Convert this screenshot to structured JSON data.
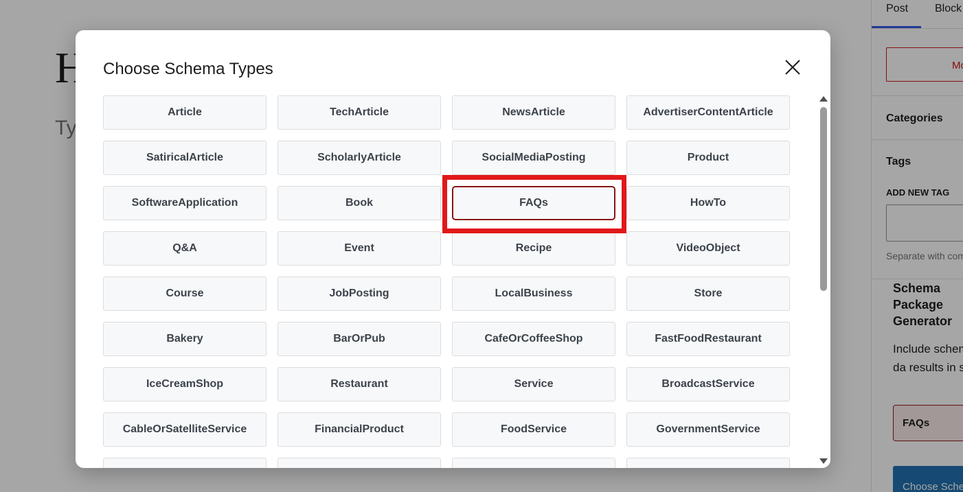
{
  "editor": {
    "title_fragment": "H",
    "placeholder_fragment": "Ty"
  },
  "sidebar": {
    "tabs": [
      {
        "label": "Post",
        "active": true
      },
      {
        "label": "Block",
        "active": false
      }
    ],
    "move_button_fragment": "Mo",
    "categories_heading": "Categories",
    "tags_heading": "Tags",
    "add_new_tag_label": "ADD NEW TAG",
    "tag_help_fragment": "Separate with com",
    "schema_panel": {
      "title": "Schema Package Generator",
      "description_fragment": "Include schem structured da results in sear",
      "selected_chip": "FAQs",
      "choose_button_fragment": "Choose Sche"
    }
  },
  "modal": {
    "title": "Choose Schema Types",
    "close_icon": "close-icon",
    "selected": "FAQs",
    "schema_types": [
      "Article",
      "TechArticle",
      "NewsArticle",
      "AdvertiserContentArticle",
      "SatiricalArticle",
      "ScholarlyArticle",
      "SocialMediaPosting",
      "Product",
      "SoftwareApplication",
      "Book",
      "FAQs",
      "HowTo",
      "Q&A",
      "Event",
      "Recipe",
      "VideoObject",
      "Course",
      "JobPosting",
      "LocalBusiness",
      "Store",
      "Bakery",
      "BarOrPub",
      "CafeOrCoffeeShop",
      "FastFoodRestaurant",
      "IceCreamShop",
      "Restaurant",
      "Service",
      "BroadcastService",
      "CableOrSatelliteService",
      "FinancialProduct",
      "FoodService",
      "GovernmentService",
      "",
      "",
      "",
      ""
    ]
  },
  "colors": {
    "accent_selected_border": "#8a1414",
    "highlight_annotation": "#e0181b",
    "primary_button": "#2271b1",
    "tab_underline": "#3858e9"
  }
}
